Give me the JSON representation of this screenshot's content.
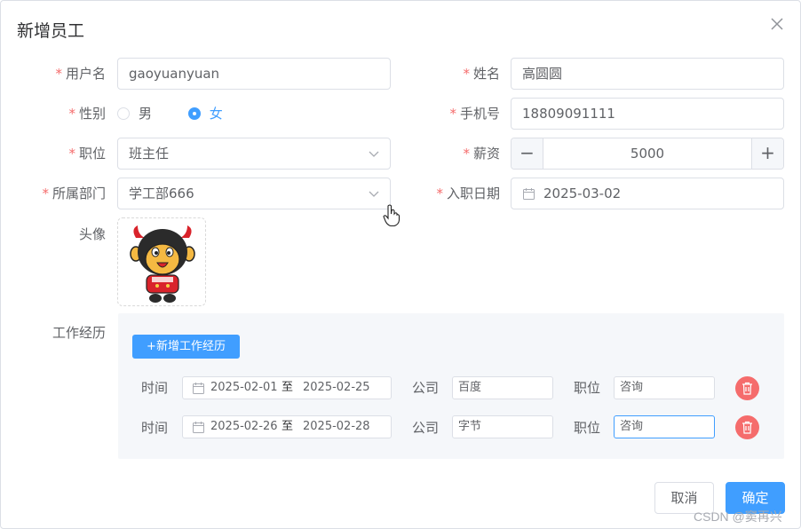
{
  "dialog": {
    "title": "新增员工",
    "close_icon": "close-icon"
  },
  "form": {
    "username": {
      "label": "用户名",
      "value": "gaoyuanyuan"
    },
    "name": {
      "label": "姓名",
      "value": "高圆圆"
    },
    "gender": {
      "label": "性别",
      "options": [
        "男",
        "女"
      ],
      "selected": "女"
    },
    "phone": {
      "label": "手机号",
      "value": "18809091111"
    },
    "position": {
      "label": "职位",
      "value": "班主任"
    },
    "salary": {
      "label": "薪资",
      "value": "5000",
      "minus": "−",
      "plus": "+"
    },
    "department": {
      "label": "所属部门",
      "value": "学工部666"
    },
    "entry_date": {
      "label": "入职日期",
      "value": "2025-03-02"
    },
    "avatar": {
      "label": "头像"
    },
    "experience": {
      "label": "工作经历",
      "add_button": "+新增工作经历",
      "time_label": "时间",
      "company_label": "公司",
      "position_label": "职位",
      "range_separator": "至",
      "rows": [
        {
          "start": "2025-02-01",
          "end": "2025-02-25",
          "company": "百度",
          "position": "咨询"
        },
        {
          "start": "2025-02-26",
          "end": "2025-02-28",
          "company": "字节",
          "position": "咨询"
        }
      ]
    }
  },
  "footer": {
    "cancel": "取消",
    "confirm": "确定"
  },
  "watermark": "CSDN @窦再兴",
  "colors": {
    "primary": "#409eff",
    "danger": "#f56c6c",
    "required": "#f56c6c"
  }
}
